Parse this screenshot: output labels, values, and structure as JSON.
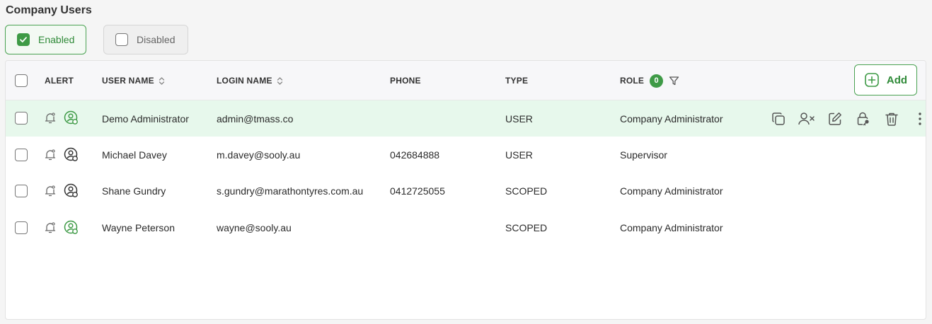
{
  "page": {
    "title": "Company Users"
  },
  "filters": {
    "enabled_label": "Enabled",
    "disabled_label": "Disabled"
  },
  "table": {
    "columns": {
      "alert": "ALERT",
      "user_name": "USER NAME",
      "login_name": "LOGIN NAME",
      "phone": "PHONE",
      "type": "TYPE",
      "role": "ROLE"
    },
    "role_filter_count": "0",
    "add_label": "Add",
    "rows": [
      {
        "user_name": "Demo Administrator",
        "login_name": "admin@tmass.co",
        "phone": "",
        "type": "USER",
        "role": "Company Administrator",
        "status": "active"
      },
      {
        "user_name": "Michael Davey",
        "login_name": "m.davey@sooly.au",
        "phone": "042684888",
        "type": "USER",
        "role": "Supervisor",
        "status": "inactive"
      },
      {
        "user_name": "Shane Gundry",
        "login_name": "s.gundry@marathontyres.com.au",
        "phone": "0412725055",
        "type": "SCOPED",
        "role": "Company Administrator",
        "status": "inactive"
      },
      {
        "user_name": "Wayne Peterson",
        "login_name": "wayne@sooly.au",
        "phone": "",
        "type": "SCOPED",
        "role": "Company Administrator",
        "status": "active"
      }
    ]
  },
  "colors": {
    "accent": "#3e9a46",
    "highlight_row": "#e7f8ec"
  },
  "icons": {
    "alert": "bell-icon",
    "status": "user-circle-icon",
    "actions": [
      "copy-icon",
      "remove-user-icon",
      "edit-icon",
      "lock-key-icon",
      "trash-icon",
      "more-vertical-icon"
    ]
  }
}
